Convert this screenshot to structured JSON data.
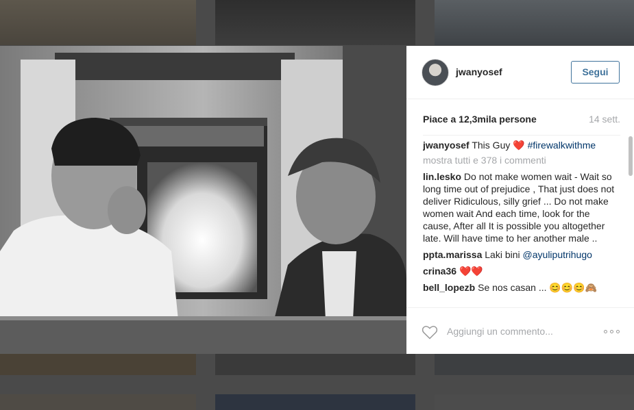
{
  "post": {
    "username": "jwanyosef",
    "follow_label": "Segui",
    "likes_text": "Piace a 12,3mila persone",
    "timestamp": "14 sett.",
    "caption": {
      "user": "jwanyosef",
      "text": "This Guy",
      "emoji": "❤️",
      "hashtag": "#firewalkwithme"
    },
    "view_all_comments": "mostra tutti e 378 i commenti",
    "comments": [
      {
        "user": "lin.lesko",
        "text": "Do not make women wait - Wait so long time out of prejudice , That just does not deliver Ridiculous, silly grief ... Do not make women wait And each time, look for the cause, After all It is possible you altogether late. Will have time to her another male .."
      },
      {
        "user": "ppta.marissa",
        "text": "Laki bini",
        "mention": "@ayuliputrihugo"
      },
      {
        "user": "crina36",
        "text": "❤️❤️"
      },
      {
        "user": "bell_lopezb",
        "text": "Se nos casan ... 😊😊😊🙈"
      }
    ],
    "comment_placeholder": "Aggiungi un commento...",
    "icons": {
      "like": "heart-outline-icon",
      "more": "more-options-icon"
    }
  },
  "colors": {
    "accent": "#3f729b",
    "text": "#262626",
    "muted": "#a5a7aa",
    "hashtag": "#003569"
  }
}
